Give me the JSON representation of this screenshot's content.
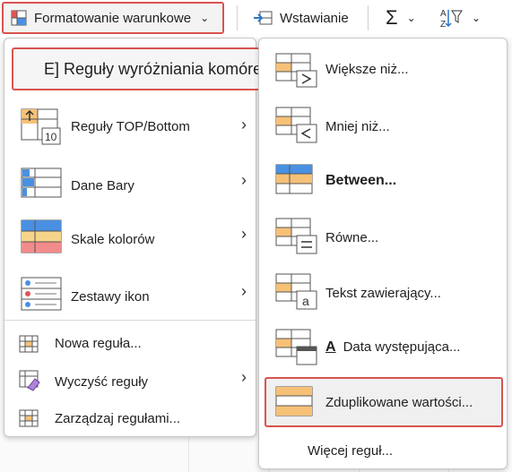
{
  "ribbon": {
    "conditional_formatting": "Formatowanie warunkowe",
    "insert": "Wstawianie",
    "sum_symbol": "Σ",
    "sort_symbol": "A/Z"
  },
  "left_menu": {
    "items": [
      {
        "label": "E] Reguły wyróżniania komórek",
        "icon": "highlight-rules-icon"
      },
      {
        "label": "Reguły TOP/Bottom",
        "icon": "top-bottom-icon"
      },
      {
        "label": "Dane  Bary",
        "icon": "data-bars-icon"
      },
      {
        "label": "Skale kolorów",
        "icon": "color-scales-icon"
      },
      {
        "label": "Zestawy ikon",
        "icon": "icon-sets-icon"
      }
    ],
    "new_rule": "Nowa reguła...",
    "clear_rules": "Wyczyść reguły",
    "manage_rules": "Zarządzaj regułami..."
  },
  "right_menu": {
    "items": [
      {
        "label": "Większe niż...",
        "icon": "greater-than-icon"
      },
      {
        "label": "Mniej niż...",
        "icon": "less-than-icon"
      },
      {
        "label": "Between...",
        "icon": "between-icon"
      },
      {
        "label": "Równe...",
        "icon": "equal-to-icon"
      },
      {
        "label": "Tekst zawierający...",
        "icon": "text-contains-icon"
      },
      {
        "label": "Data występująca...",
        "icon": "date-occurring-icon",
        "prefix": "A"
      },
      {
        "label": "Zduplikowane wartości...",
        "icon": "duplicate-values-icon"
      }
    ],
    "more_rules": "Więcej reguł..."
  },
  "colors": {
    "highlight_border": "#d9534f",
    "orange_fill": "#f6c177",
    "blue_fill": "#4a90e2"
  }
}
